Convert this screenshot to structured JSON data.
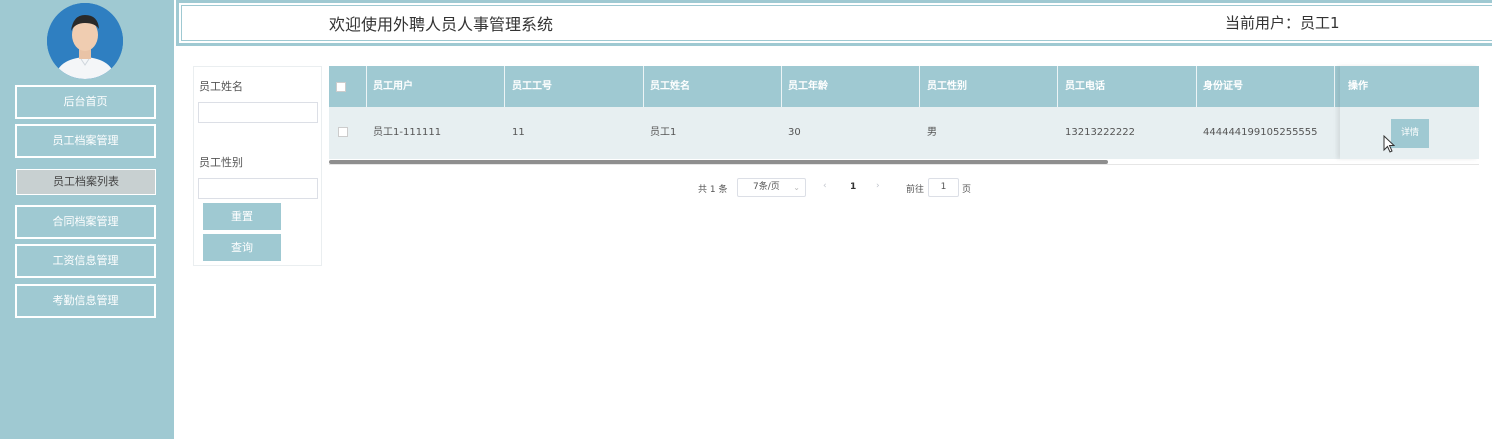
{
  "sidebar": {
    "items": [
      {
        "label": "后台首页"
      },
      {
        "label": "员工档案管理"
      },
      {
        "label": "员工档案列表"
      },
      {
        "label": "合同档案管理"
      },
      {
        "label": "工资信息管理"
      },
      {
        "label": "考勤信息管理"
      }
    ]
  },
  "header": {
    "title": "欢迎使用外聘人员人事管理系统",
    "current_user": "当前用户：员工1"
  },
  "search": {
    "name_label": "员工姓名",
    "name_value": "",
    "gender_label": "员工性别",
    "gender_value": "",
    "reset_label": "重置",
    "query_label": "查询"
  },
  "table": {
    "columns": [
      "员工用户",
      "员工工号",
      "员工姓名",
      "员工年龄",
      "员工性别",
      "员工电话",
      "身份证号",
      "操作"
    ],
    "rows": [
      {
        "user": "员工1-111111",
        "no": "11",
        "name": "员工1",
        "age": "30",
        "gender": "男",
        "phone": "13213222222",
        "idcard": "444444199105255555",
        "action": "详情"
      }
    ]
  },
  "pagination": {
    "total": "共 1 条",
    "page_size": "7条/页",
    "current_page": "1",
    "goto_label": "前往",
    "goto_value": "1",
    "page_suffix": "页"
  },
  "colors": {
    "accent": "#9fc9d2",
    "row_bg": "#e7eff1"
  }
}
